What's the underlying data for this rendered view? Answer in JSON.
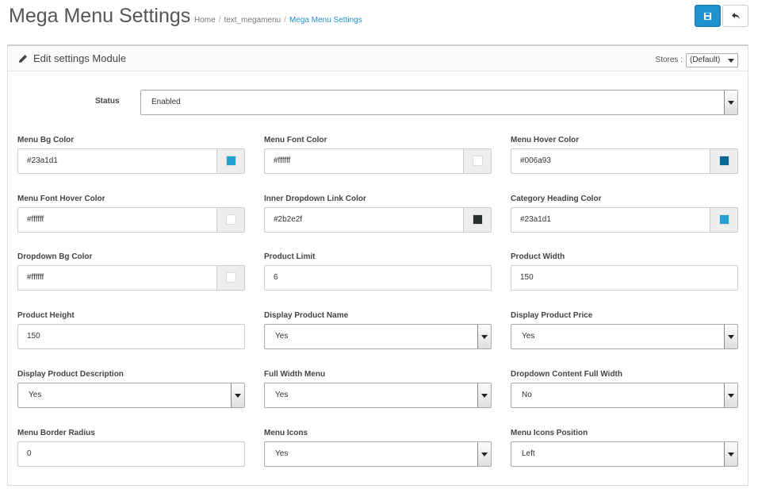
{
  "header": {
    "title": "Mega Menu Settings",
    "breadcrumb": [
      "Home",
      "text_megamenu",
      "Mega Menu Settings"
    ],
    "save_icon": "save-icon",
    "back_icon": "reply-icon"
  },
  "panel": {
    "title": "Edit settings Module",
    "icon": "pencil-icon",
    "stores_label": "Stores :",
    "stores_value": "(Default)"
  },
  "status": {
    "label": "Status",
    "value": "Enabled"
  },
  "colors": {
    "menu_bg": {
      "label": "Menu Bg Color",
      "value": "#23a1d1",
      "swatch": "#23a1d1"
    },
    "menu_font": {
      "label": "Menu Font Color",
      "value": "#ffffff",
      "swatch": "#ffffff"
    },
    "menu_hover": {
      "label": "Menu Hover Color",
      "value": "#006a93",
      "swatch": "#006a93"
    },
    "menu_font_hover": {
      "label": "Menu Font Hover Color",
      "value": "#ffffff",
      "swatch": "#ffffff"
    },
    "inner_dropdown_link": {
      "label": "Inner Dropdown Link Color",
      "value": "#2b2e2f",
      "swatch": "#2b2e2f"
    },
    "category_heading": {
      "label": "Category Heading Color",
      "value": "#23a1d1",
      "swatch": "#23a1d1"
    },
    "dropdown_bg": {
      "label": "Dropdown Bg Color",
      "value": "#ffffff",
      "swatch": "#ffffff"
    }
  },
  "fields": {
    "product_limit": {
      "label": "Product Limit",
      "value": "6"
    },
    "product_width": {
      "label": "Product Width",
      "value": "150"
    },
    "product_height": {
      "label": "Product Height",
      "value": "150"
    },
    "display_product_name": {
      "label": "Display Product Name",
      "value": "Yes"
    },
    "display_product_price": {
      "label": "Display Product Price",
      "value": "Yes"
    },
    "display_product_description": {
      "label": "Display Product Description",
      "value": "Yes"
    },
    "full_width_menu": {
      "label": "Full Width Menu",
      "value": "Yes"
    },
    "dropdown_content_full_width": {
      "label": "Dropdown Content Full Width",
      "value": "No"
    },
    "menu_border_radius": {
      "label": "Menu Border Radius",
      "value": "0"
    },
    "menu_icons": {
      "label": "Menu Icons",
      "value": "Yes"
    },
    "menu_icons_position": {
      "label": "Menu Icons Position",
      "value": "Left"
    }
  },
  "theme": {
    "primary": "#1e91cf"
  }
}
